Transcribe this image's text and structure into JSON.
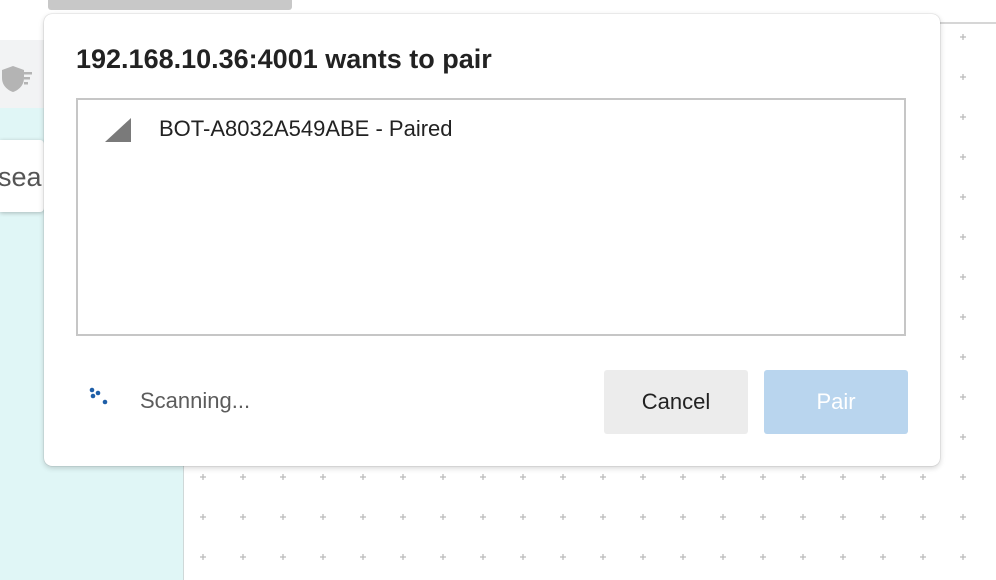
{
  "background": {
    "left_panel_search_fragment": "sea",
    "colors": {
      "left_panel": "#e0f6f6",
      "canvas_dots": "#b8b8b8"
    }
  },
  "dialog": {
    "title": "192.168.10.36:4001 wants to pair",
    "devices": [
      {
        "label": "BOT-A8032A549ABE - Paired",
        "icon": "signal-strength-icon"
      }
    ],
    "status": "Scanning...",
    "cancel_label": "Cancel",
    "pair_label": "Pair",
    "pair_enabled": false,
    "colors": {
      "pair_disabled_bg": "#b9d5ee",
      "spinner": "#1f5fa8"
    }
  }
}
